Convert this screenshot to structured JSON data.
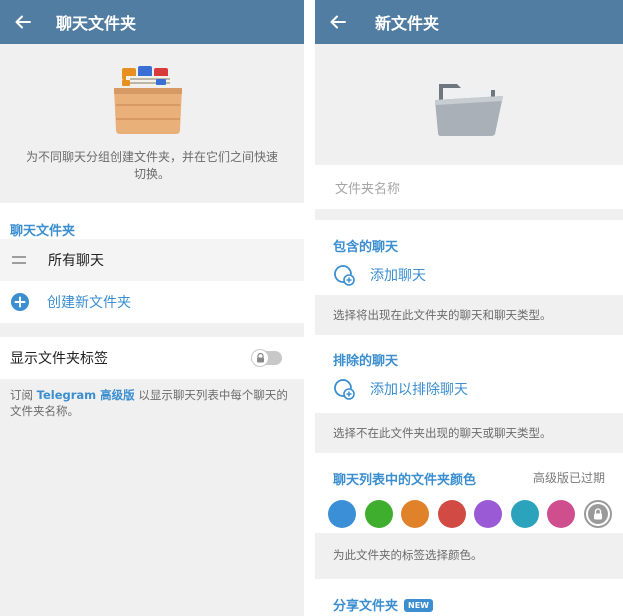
{
  "left": {
    "title": "聊天文件夹",
    "hero_desc": "为不同聊天分组创建文件夹，并在它们之间快速切换。",
    "section_title": "聊天文件夹",
    "folders": [
      {
        "label": "所有聊天"
      }
    ],
    "create_label": "创建新文件夹",
    "show_tags_label": "显示文件夹标签",
    "tags_toggle_on": false,
    "tip_prefix": "订阅 ",
    "tip_bold": "Telegram 高级版",
    "tip_suffix": " 以显示聊天列表中每个聊天的文件夹名称。"
  },
  "right": {
    "title": "新文件夹",
    "name_placeholder": "文件夹名称",
    "included_title": "包含的聊天",
    "add_chats_label": "添加聊天",
    "included_tip": "选择将出现在此文件夹的聊天和聊天类型。",
    "excluded_title": "排除的聊天",
    "add_excluded_label": "添加以排除聊天",
    "excluded_tip": "选择不在此文件夹出现的聊天或聊天类型。",
    "color_title": "聊天列表中的文件夹颜色",
    "color_status": "高级版已过期",
    "colors": [
      "#3a8fd6",
      "#3fae2e",
      "#e0822a",
      "#d14a44",
      "#9a5ad6",
      "#2ca3bd",
      "#cf4f8e"
    ],
    "color_tip": "为此文件夹的标签选择颜色。",
    "share_title": "分享文件夹",
    "new_badge": "NEW"
  }
}
